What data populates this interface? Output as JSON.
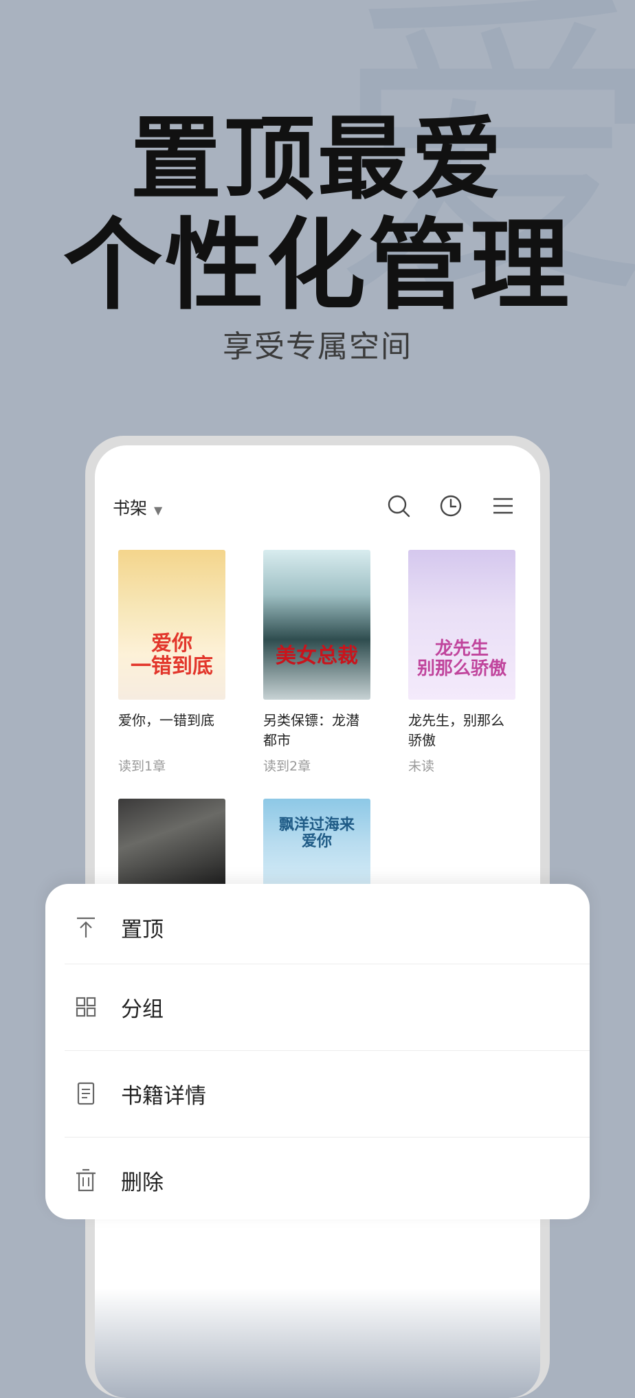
{
  "hero": {
    "line1": "置顶最爱",
    "line2": "个性化管理",
    "subtitle": "享受专属空间"
  },
  "shelf": {
    "title": "书架",
    "icons": [
      "search-icon",
      "history-clock-icon",
      "menu-icon"
    ],
    "books": [
      {
        "title": "爱你，一错到底",
        "progress": "读到1章",
        "cover_text": "爱你\n一错到底"
      },
      {
        "title": "另类保镖：龙潜都市",
        "progress": "读到2章",
        "cover_text": "美女总裁"
      },
      {
        "title": "龙先生，别那么骄傲",
        "progress": "未读",
        "cover_text": "龙先生\n别那么骄傲"
      },
      {
        "title": "",
        "progress": "",
        "cover_text": ""
      },
      {
        "title": "",
        "progress": "",
        "cover_text": "飘洋过海来爱你"
      }
    ]
  },
  "menu": {
    "items": [
      {
        "label": "置顶",
        "icon": "pin-top-icon"
      },
      {
        "label": "分组",
        "icon": "grid-icon"
      },
      {
        "label": "书籍详情",
        "icon": "document-icon"
      },
      {
        "label": "删除",
        "icon": "trash-icon"
      }
    ]
  }
}
